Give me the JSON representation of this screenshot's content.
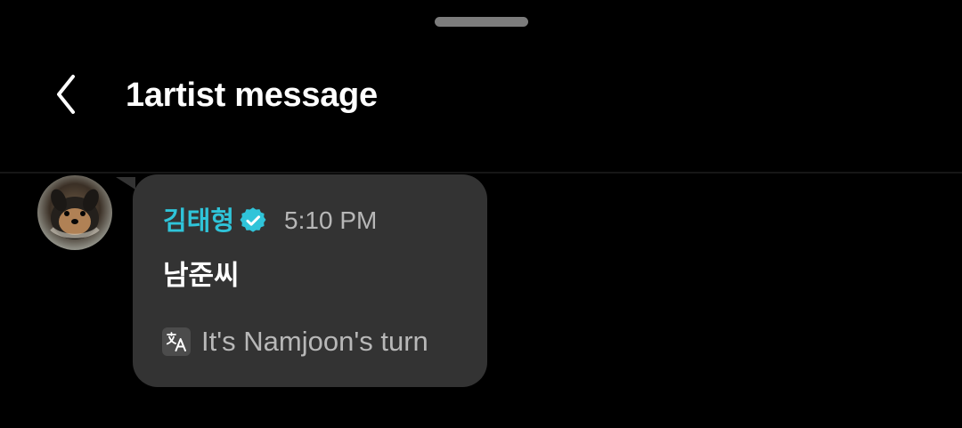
{
  "header": {
    "title": "1artist message",
    "back_icon": "chevron-left-icon"
  },
  "message": {
    "sender": "김태형",
    "verified_icon": "verified-badge-icon",
    "time": "5:10 PM",
    "text": "남준씨",
    "translation_icon": "translate-icon",
    "translation": "It's Namjoon's turn"
  },
  "colors": {
    "background": "#000000",
    "bubble": "#333333",
    "sender_accent": "#2fc4d9",
    "muted_text": "#b8b8b8"
  }
}
